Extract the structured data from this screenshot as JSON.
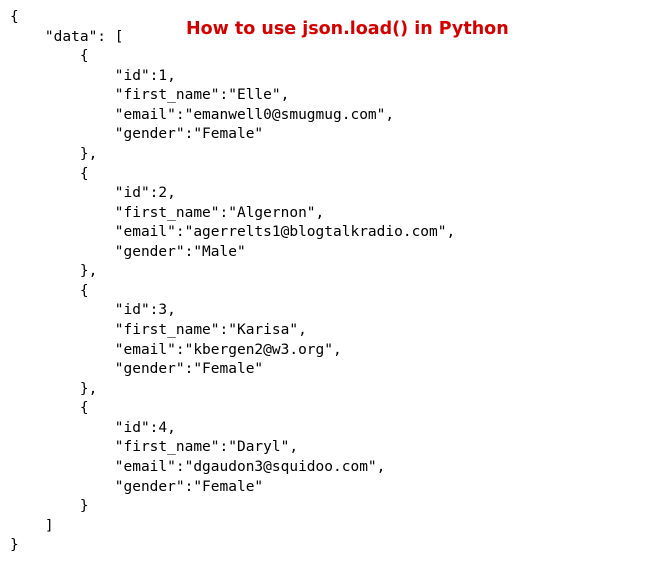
{
  "title": "How to use json.load() in Python",
  "code": {
    "key_data": "data",
    "records": [
      {
        "id": 1,
        "first_name": "Elle",
        "email": "emanwell0@smugmug.com",
        "gender": "Female"
      },
      {
        "id": 2,
        "first_name": "Algernon",
        "email": "agerrelts1@blogtalkradio.com",
        "gender": "Male"
      },
      {
        "id": 3,
        "first_name": "Karisa",
        "email": "kbergen2@w3.org",
        "gender": "Female"
      },
      {
        "id": 4,
        "first_name": "Daryl",
        "email": "dgaudon3@squidoo.com",
        "gender": "Female"
      }
    ],
    "field_keys": {
      "id": "id",
      "first_name": "first_name",
      "email": "email",
      "gender": "gender"
    }
  }
}
